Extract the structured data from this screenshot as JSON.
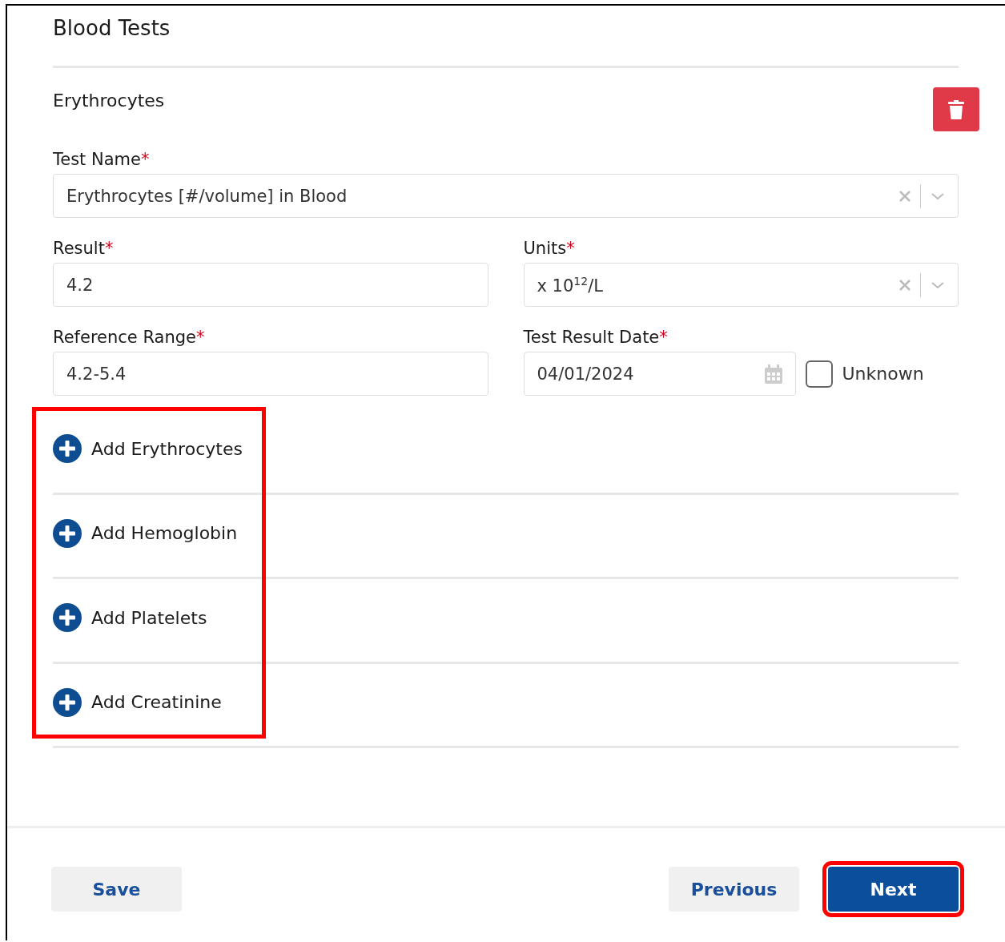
{
  "section": {
    "title": "Blood Tests"
  },
  "test": {
    "title": "Erythrocytes",
    "fields": [
      {
        "kind": "select",
        "label": "Test Name",
        "required_mark": "*",
        "value": "Erythrocytes [#/volume] in Blood",
        "wide": true
      },
      {
        "kind": "text",
        "label": "Result",
        "required_mark": "*",
        "value": "4.2"
      },
      {
        "kind": "select",
        "label": "Units",
        "required_mark": "*",
        "value": "x 10$^{12}$/L"
      },
      {
        "kind": "text",
        "label": "Reference Range",
        "required_mark": "*",
        "value": "4.2-5.4"
      },
      {
        "kind": "date",
        "label": "Test Result Date",
        "required_mark": "*",
        "value": "04/01/2024",
        "unknown": {
          "label": "Unknown",
          "checked": false
        }
      }
    ]
  },
  "add_links": {
    "highlighted": true,
    "items": [
      "Add Erythrocytes",
      "Add Hemoglobin",
      "Add Platelets",
      "Add Creatinine"
    ]
  },
  "buttons": [
    {
      "label": "Save",
      "kind": "secondary",
      "highlighted": false
    },
    {
      "label": "Previous",
      "kind": "secondary",
      "highlighted": false
    },
    {
      "label": "Next",
      "kind": "primary",
      "highlighted": true
    }
  ]
}
